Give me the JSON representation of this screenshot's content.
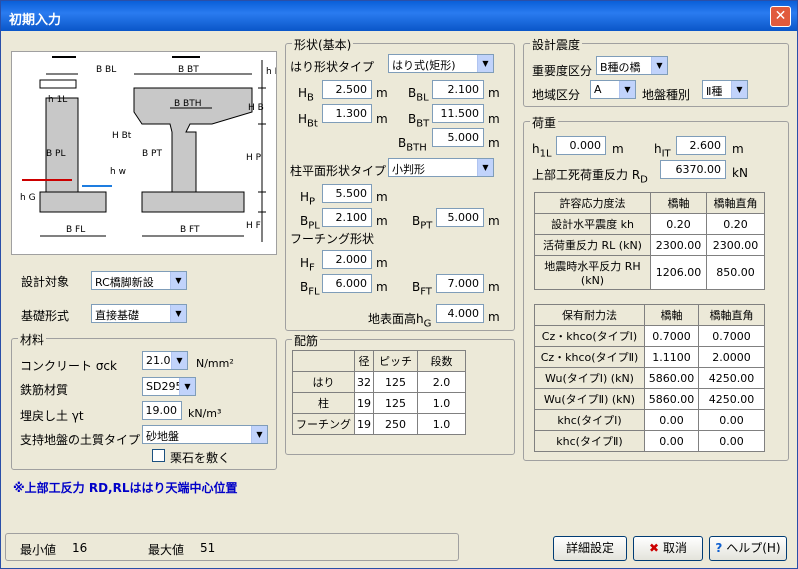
{
  "title": "初期入力",
  "close": "✕",
  "design": {
    "target_label": "設計対象",
    "target_value": "RC橋脚新設",
    "found_label": "基礎形式",
    "found_value": "直接基礎"
  },
  "material": {
    "legend": "材料",
    "concrete_label": "コンクリート σck",
    "concrete_value": "21.0",
    "concrete_unit": "N/mm²",
    "rebar_label": "鉄筋材質",
    "rebar_value": "SD295",
    "soil_label": "埋戻し土 γt",
    "soil_value": "19.00",
    "soil_unit": "kN/m³",
    "ground_label": "支持地盤の土質タイプ",
    "ground_value": "砂地盤",
    "gravel_label": "栗石を敷く"
  },
  "note": "※上部工反力 RD,RLははり天端中心位置",
  "shape": {
    "legend": "形状(基本)",
    "beam_type_label": "はり形状タイプ",
    "beam_type_value": "はり式(矩形)",
    "HB": "2.500",
    "BBL": "2.100",
    "HBt": "1.300",
    "BBT": "11.500",
    "BBTH": "5.000",
    "col_type_label": "柱平面形状タイプ",
    "col_type_value": "小判形",
    "HP": "5.500",
    "BPL": "2.100",
    "BPT": "5.000",
    "footing_label": "フーチング形状",
    "HF": "2.000",
    "BFL": "6.000",
    "BFT": "7.000",
    "ground_h_label": "地表面高",
    "hG": "4.000",
    "unit": "m"
  },
  "rebar": {
    "legend": "配筋",
    "headers": [
      "",
      "径",
      "ピッチ",
      "段数"
    ],
    "rows": [
      [
        "はり",
        "32",
        "125",
        "2.0"
      ],
      [
        "柱",
        "19",
        "125",
        "1.0"
      ],
      [
        "フーチング",
        "19",
        "250",
        "1.0"
      ]
    ]
  },
  "seismic": {
    "legend": "設計震度",
    "importance_label": "重要度区分",
    "importance_value": "B種の橋",
    "region_label": "地域区分",
    "region_value": "A",
    "groundtype_label": "地盤種別",
    "groundtype_value": "Ⅱ種"
  },
  "load": {
    "legend": "荷重",
    "h1L": "0.000",
    "hIT": "2.600",
    "rd_label": "上部工死荷重反力",
    "rd_value": "6370.00",
    "unit_m": "m",
    "unit_kn": "kN",
    "allow_headers": [
      "許容応力度法",
      "橋軸",
      "橋軸直角"
    ],
    "allow_rows": [
      [
        "設計水平震度 kh",
        "0.20",
        "0.20"
      ],
      [
        "活荷重反力 RL (kN)",
        "2300.00",
        "2300.00"
      ],
      [
        "地震時水平反力 RH (kN)",
        "1206.00",
        "850.00"
      ]
    ],
    "cap_headers": [
      "保有耐力法",
      "橋軸",
      "橋軸直角"
    ],
    "cap_rows": [
      [
        "Cz・khco(タイプⅠ)",
        "0.7000",
        "0.7000"
      ],
      [
        "Cz・khco(タイプⅡ)",
        "1.1100",
        "2.0000"
      ],
      [
        "Wu(タイプⅠ) (kN)",
        "5860.00",
        "4250.00"
      ],
      [
        "Wu(タイプⅡ) (kN)",
        "5860.00",
        "4250.00"
      ],
      [
        "khc(タイプⅠ)",
        "0.00",
        "0.00"
      ],
      [
        "khc(タイプⅡ)",
        "0.00",
        "0.00"
      ]
    ]
  },
  "status": {
    "min_label": "最小値",
    "min_value": "16",
    "max_label": "最大値",
    "max_value": "51"
  },
  "buttons": {
    "detail": "詳細設定",
    "cancel": "取消",
    "help": "ヘルプ(H)"
  },
  "diagram": {
    "BBL": "B BL",
    "BBT": "B BT",
    "BBTH": "B BTH",
    "h1L": "h 1L",
    "hIT": "h IT",
    "HB": "H B",
    "HBt": "H Bt",
    "BPL": "B PL",
    "BPT": "B PT",
    "hw": "h w",
    "HP": "H P",
    "hG": "h G",
    "HF": "H F",
    "BFL": "B FL",
    "BFT": "B FT"
  }
}
